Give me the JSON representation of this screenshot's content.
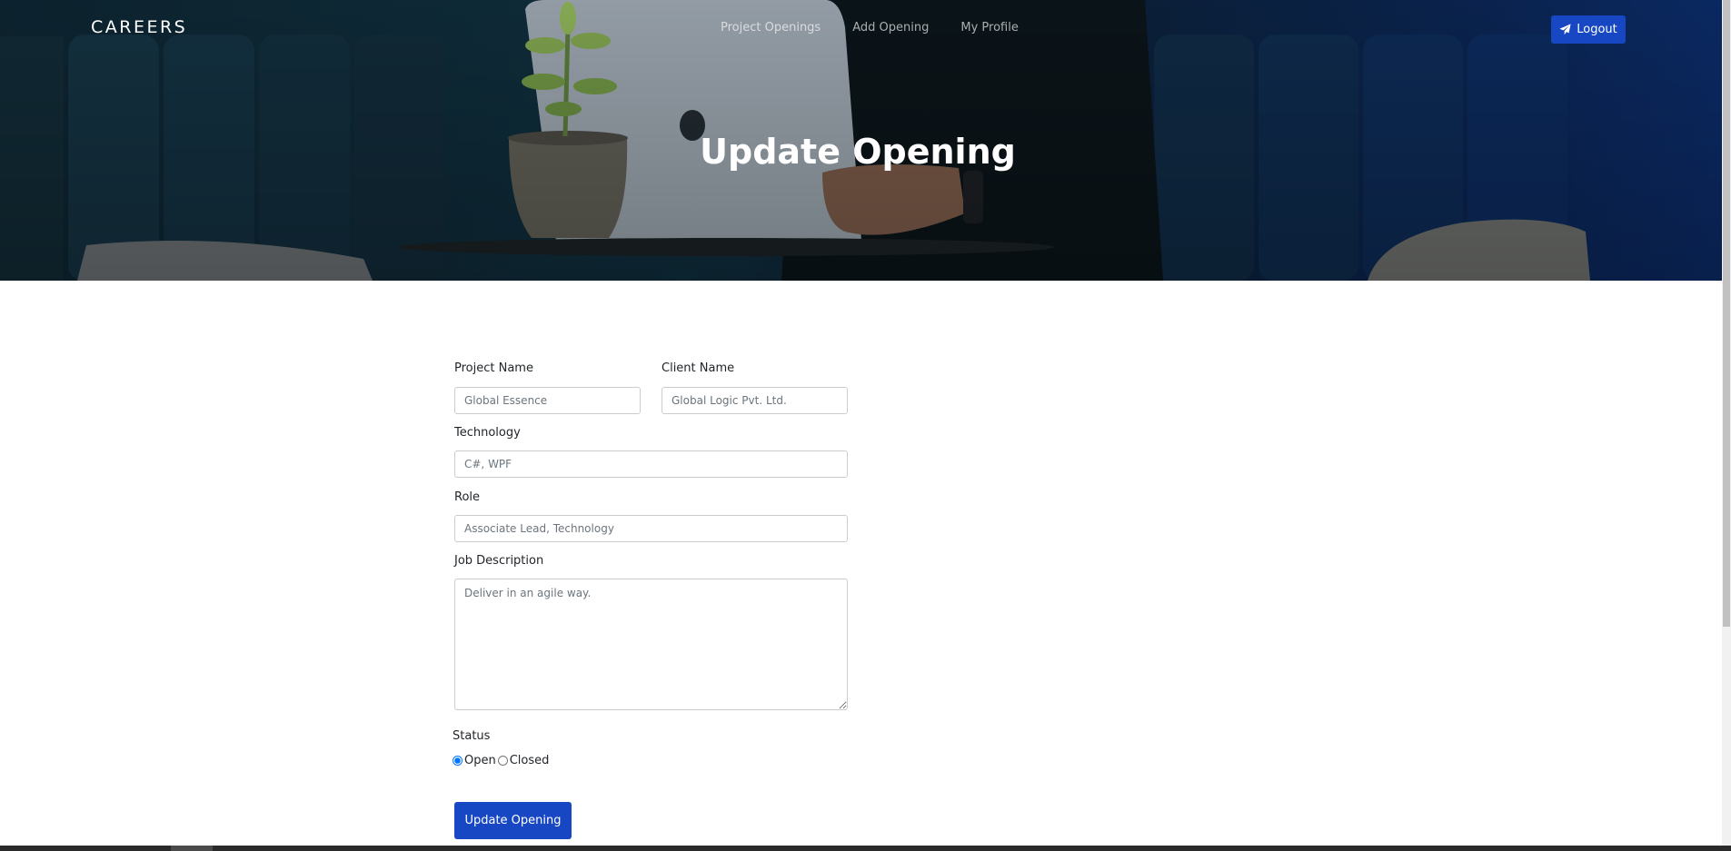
{
  "header": {
    "brand": "CAREERS",
    "nav": [
      "Project Openings",
      "Add Opening",
      "My Profile"
    ],
    "logout_label": "Logout",
    "title": "Update Opening"
  },
  "form": {
    "project_name": {
      "label": "Project Name",
      "value": "Global Essence"
    },
    "client_name": {
      "label": "Client Name",
      "value": "Global Logic Pvt. Ltd."
    },
    "technology": {
      "label": "Technology",
      "value": "C#, WPF"
    },
    "role": {
      "label": "Role",
      "value": "Associate Lead, Technology"
    },
    "job_description": {
      "label": "Job Description",
      "value": "Deliver in an agile way."
    },
    "status": {
      "label": "Status",
      "options": [
        "Open",
        "Closed"
      ],
      "selected": "Open"
    },
    "submit_label": "Update Opening"
  },
  "colors": {
    "primary": "#1747c2",
    "hero_dark": "#0d2430",
    "hero_blue": "#0b2a66"
  },
  "icons": {
    "logout": "paper-plane-icon"
  }
}
